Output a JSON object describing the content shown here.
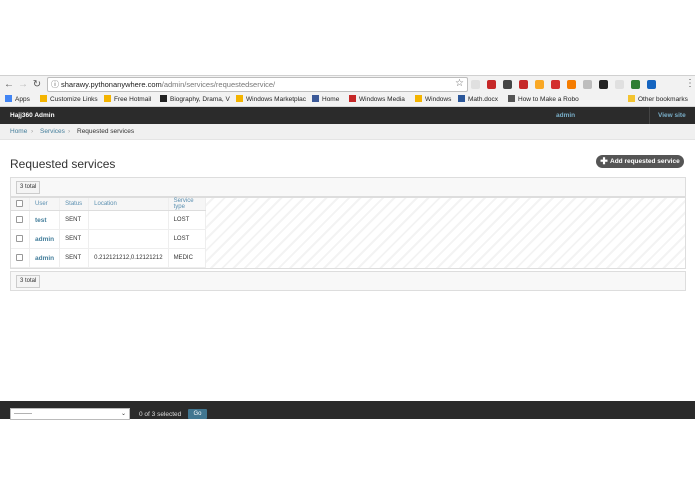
{
  "browser": {
    "url_host": "sharawy.pythonanywhere.com",
    "url_path": "/admin/services/requestedservice/",
    "extension_colors": [
      "#e0e0e0",
      "#c62828",
      "#444444",
      "#c62828",
      "#f9a825",
      "#d32f2f",
      "#f57c00",
      "#bdbdbd",
      "#222222",
      "#e0e0e0",
      "#2e7d32",
      "#1565c0"
    ],
    "bookmarks": [
      {
        "label": "Apps",
        "icon": "apps-grid-icon",
        "color": "#4285f4"
      },
      {
        "label": "Customize Links",
        "icon": "windows-logo-icon",
        "color": "#f4b400"
      },
      {
        "label": "Free Hotmail",
        "icon": "windows-logo-icon",
        "color": "#f4b400"
      },
      {
        "label": "Biography, Drama, V",
        "icon": "p-logo-icon",
        "color": "#222222"
      },
      {
        "label": "Windows Marketplac",
        "icon": "windows-logo-icon",
        "color": "#f4b400"
      },
      {
        "label": "Home",
        "icon": "facebook-icon",
        "color": "#3b5998"
      },
      {
        "label": "Windows Media",
        "icon": "media-icon",
        "color": "#c62828"
      },
      {
        "label": "Windows",
        "icon": "windows-logo-icon",
        "color": "#f4b400"
      },
      {
        "label": "Math.docx",
        "icon": "word-icon",
        "color": "#2b579a"
      },
      {
        "label": "How to Make a Robo",
        "icon": "page-icon",
        "color": "#555555"
      },
      {
        "label": "Other bookmarks",
        "icon": "folder-icon",
        "color": "#f4c430"
      }
    ]
  },
  "admin": {
    "site_name": "Hajj360 Admin",
    "user": "admin",
    "view_site": "View site",
    "breadcrumb": {
      "home": "Home",
      "section": "Services",
      "current": "Requested services"
    },
    "page_title": "Requested services",
    "add_button": "Add requested service",
    "count_label": "3 total",
    "columns": [
      "User",
      "Status",
      "Location",
      "Service type"
    ],
    "rows": [
      {
        "user": "test",
        "status": "SENT",
        "location": "",
        "service_type": "LOST"
      },
      {
        "user": "admin",
        "status": "SENT",
        "location": "",
        "service_type": "LOST"
      },
      {
        "user": "admin",
        "status": "SENT",
        "location": "0.212121212,0.12121212",
        "service_type": "MEDIC"
      }
    ],
    "action_select": "---------",
    "selected_count": "0 of 3 selected",
    "go_button": "Go"
  },
  "colors": {
    "header_bg": "#2b2b2b",
    "link": "#447e9b",
    "header_link": "#79aec8",
    "go_button": "#417690"
  }
}
